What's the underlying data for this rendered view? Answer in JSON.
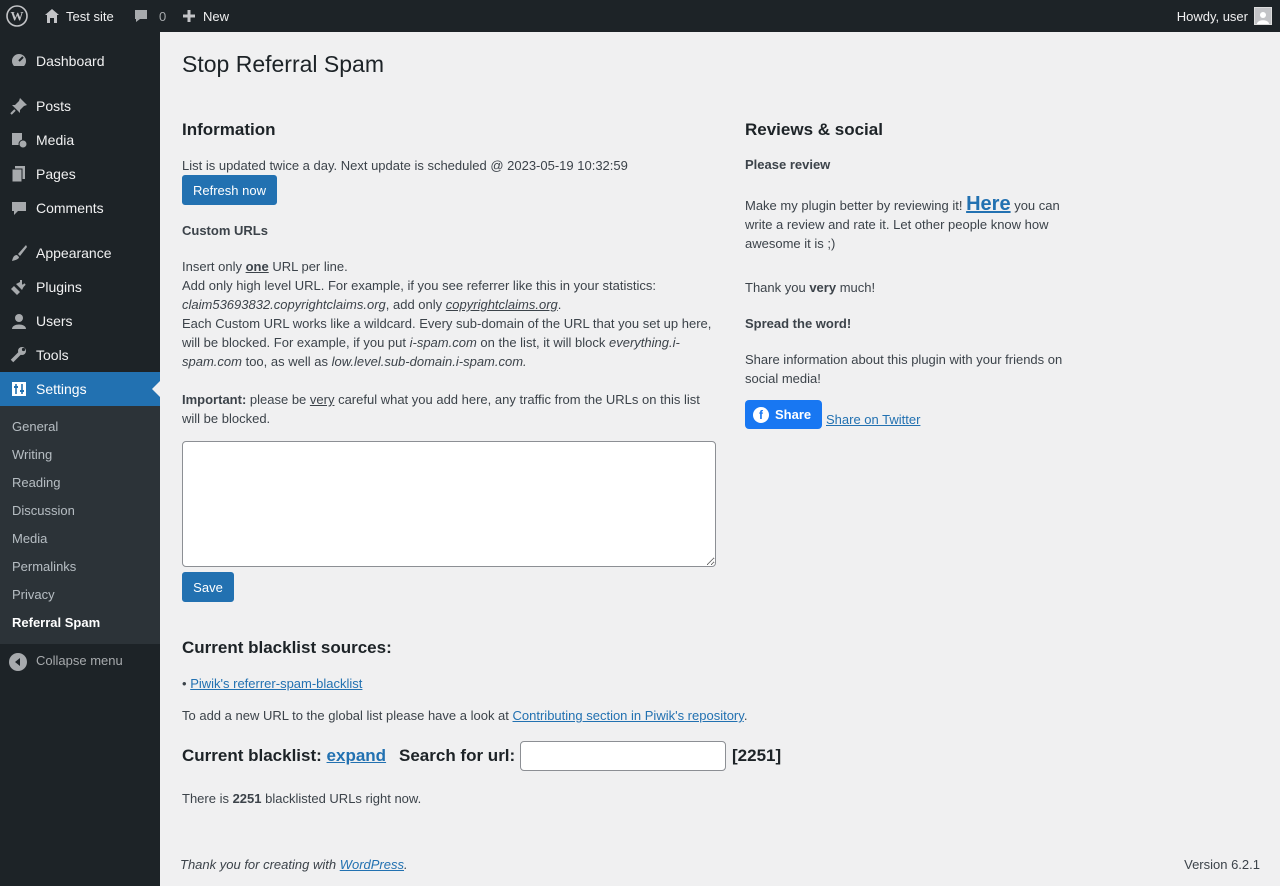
{
  "adminbar": {
    "site_name": "Test site",
    "comments_count": "0",
    "new_label": "New",
    "howdy": "Howdy, user"
  },
  "sidebar": {
    "items": [
      {
        "label": "Dashboard",
        "icon": "dashboard-icon"
      },
      {
        "label": "Posts",
        "icon": "pin-icon"
      },
      {
        "label": "Media",
        "icon": "media-icon"
      },
      {
        "label": "Pages",
        "icon": "pages-icon"
      },
      {
        "label": "Comments",
        "icon": "comment-icon"
      },
      {
        "label": "Appearance",
        "icon": "brush-icon"
      },
      {
        "label": "Plugins",
        "icon": "plug-icon"
      },
      {
        "label": "Users",
        "icon": "user-icon"
      },
      {
        "label": "Tools",
        "icon": "wrench-icon"
      },
      {
        "label": "Settings",
        "icon": "settings-icon"
      }
    ],
    "submenu": [
      "General",
      "Writing",
      "Reading",
      "Discussion",
      "Media",
      "Permalinks",
      "Privacy",
      "Referral Spam"
    ],
    "collapse": "Collapse menu"
  },
  "page": {
    "title": "Stop Referral Spam"
  },
  "info": {
    "heading": "Information",
    "update_text": "List is updated twice a day. Next update is scheduled @ 2023-05-19 10:32:59",
    "refresh_button": "Refresh now",
    "custom_urls_heading": "Custom URLs",
    "insert_pre": "Insert only ",
    "insert_bold": "one",
    "insert_post": " URL per line.",
    "add_high_level": "Add only high level URL. For example, if you see referrer like this in your statistics:",
    "example_referrer": "claim53693832.copyrightclaims.org",
    "add_only": ", add only ",
    "example_domain": "copyrightclaims.org",
    "period": ".",
    "wildcard_pre": "Each Custom URL works like a wildcard. Every sub-domain of the URL that you set up here, will be blocked. For example, if you put ",
    "wildcard_example": "i-spam.com",
    "wildcard_mid": " on the list, it will block ",
    "wildcard_block1": "everything.i-spam.com",
    "wildcard_mid2": " too, as well as ",
    "wildcard_block2": "low.level.sub-domain.i-spam.com.",
    "important_bold": "Important:",
    "important_pre": " please be ",
    "important_very": "very",
    "important_post": " careful what you add here, any traffic from the URLs on this list will be blocked.",
    "save_button": "Save"
  },
  "reviews": {
    "heading": "Reviews & social",
    "please_review": "Please review",
    "make_better": "Make my plugin better by reviewing it! ",
    "here_link": "Here",
    "make_better_post": " you can write a review and rate it. Let other people know how awesome it is ;)",
    "thank_pre": "Thank you ",
    "thank_bold": "very",
    "thank_post": " much!",
    "spread": "Spread the word!",
    "share_info": "Share information about this plugin with your friends on social media!",
    "fb_share": "Share",
    "twitter_share": "Share on Twitter"
  },
  "blacklist": {
    "sources_heading": "Current blacklist sources:",
    "bullet": "•",
    "source_link": "Piwik's referrer-spam-blacklist",
    "add_new_pre": "To add a new URL to the global list please have a look at ",
    "add_new_link": "Contributing section in Piwik's repository",
    "add_new_post": ".",
    "current_label": "Current blacklist:",
    "expand": "expand",
    "search_label": "Search for url:",
    "search_value": "",
    "count_badge": "[2251]",
    "there_is_pre": "There is ",
    "there_is_count": "2251",
    "there_is_post": " blacklisted URLs right now."
  },
  "footer": {
    "thanks_pre": "Thank you for creating with ",
    "wordpress_link": "WordPress",
    "thanks_post": ".",
    "version": "Version 6.2.1"
  }
}
